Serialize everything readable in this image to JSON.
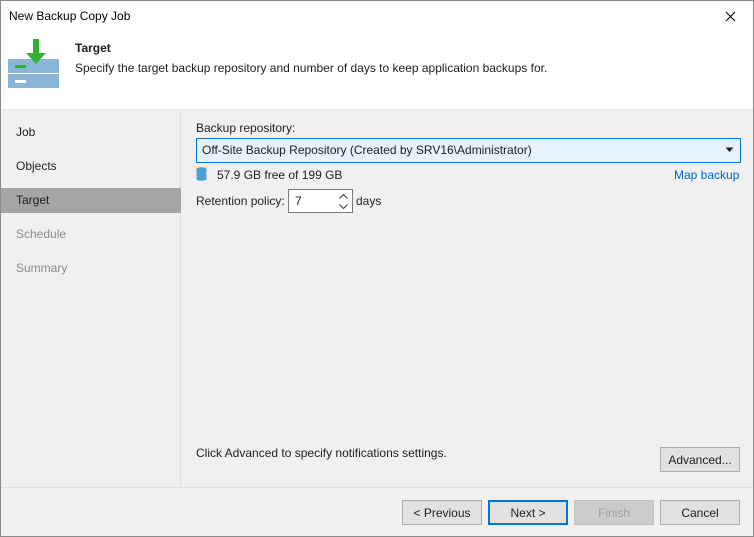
{
  "window": {
    "title": "New Backup Copy Job"
  },
  "header": {
    "title": "Target",
    "description": "Specify the target backup repository and number of days to keep application backups for."
  },
  "nav": {
    "items": [
      {
        "label": "Job",
        "state": "normal"
      },
      {
        "label": "Objects",
        "state": "normal"
      },
      {
        "label": "Target",
        "state": "active"
      },
      {
        "label": "Schedule",
        "state": "disabled"
      },
      {
        "label": "Summary",
        "state": "disabled"
      }
    ]
  },
  "main": {
    "repository_label": "Backup repository:",
    "repository_value": "Off-Site Backup Repository (Created by SRV16\\Administrator)",
    "free_space": "57.9 GB free of 199 GB",
    "map_backup_link": "Map backup",
    "retention_label": "Retention policy:",
    "retention_value": "7",
    "retention_unit": "days",
    "advanced_hint": "Click Advanced to specify notifications settings.",
    "advanced_button": "Advanced..."
  },
  "footer": {
    "previous": "< Previous",
    "next": "Next >",
    "finish": "Finish",
    "cancel": "Cancel"
  },
  "colors": {
    "accent": "#0078d7",
    "link": "#0066cc",
    "nav_active": "#a5a5a5",
    "icon_green": "#2eb135",
    "icon_panel": "#8ab5d6"
  },
  "icons": {
    "header": "backup-copy-target-icon",
    "close": "close-icon",
    "dropdown": "chevron-down-icon",
    "storage": "database-icon"
  }
}
